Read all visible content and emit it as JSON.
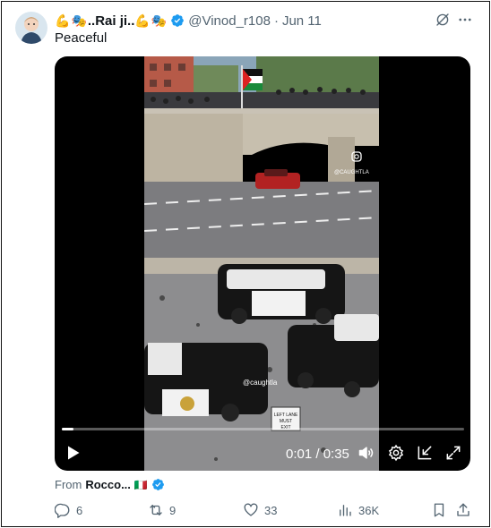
{
  "tweet": {
    "author_name": "..Rai ji..",
    "handle": "@Vinod_r108",
    "separator": "·",
    "date": "Jun 11",
    "text": "Peaceful"
  },
  "icons": {
    "avatar": "baby-avatar-icon",
    "verified": "verified-badge-icon",
    "grok": "grok-icon",
    "more": "more-icon"
  },
  "video": {
    "watermark_top": "@CAUGHTLA",
    "watermark_mid": "@caughtla",
    "sign_text": "LEFT LANE MUST EXIT",
    "current_time": "0:01",
    "duration": "0:35",
    "time_display": "0:01 / 0:35",
    "progress_fraction": 0.03
  },
  "attribution": {
    "prefix": "From",
    "name": "Rocco...",
    "flag": "🇮🇹"
  },
  "actions": {
    "replies": "6",
    "reposts": "9",
    "likes": "33",
    "views": "36K"
  },
  "colors": {
    "verified": "#1d9bf0",
    "muted_text": "#536471",
    "primary_text": "#0f1419"
  }
}
